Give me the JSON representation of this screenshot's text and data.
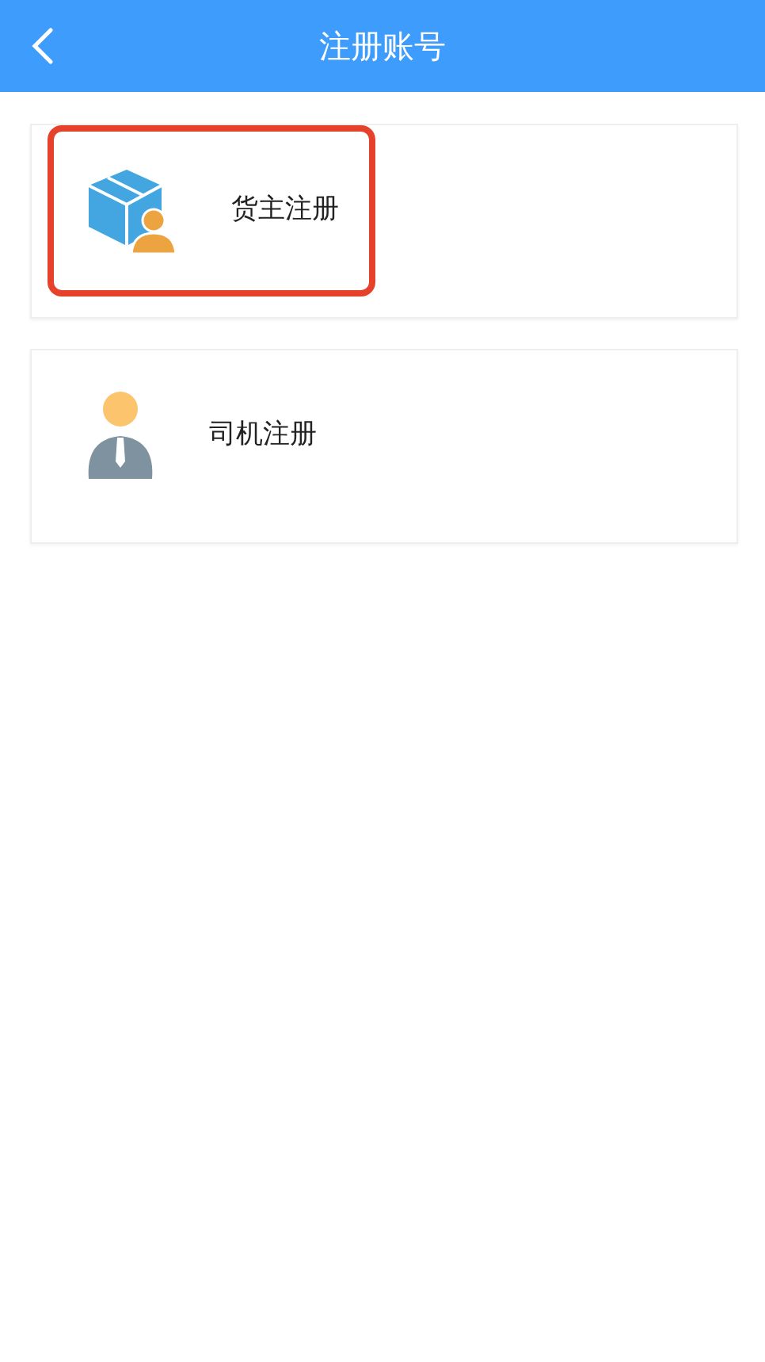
{
  "header": {
    "title": "注册账号"
  },
  "options": [
    {
      "kind": "cargo-owner",
      "label": "货主注册",
      "highlighted": true
    },
    {
      "kind": "driver",
      "label": "司机注册",
      "highlighted": false
    }
  ]
}
